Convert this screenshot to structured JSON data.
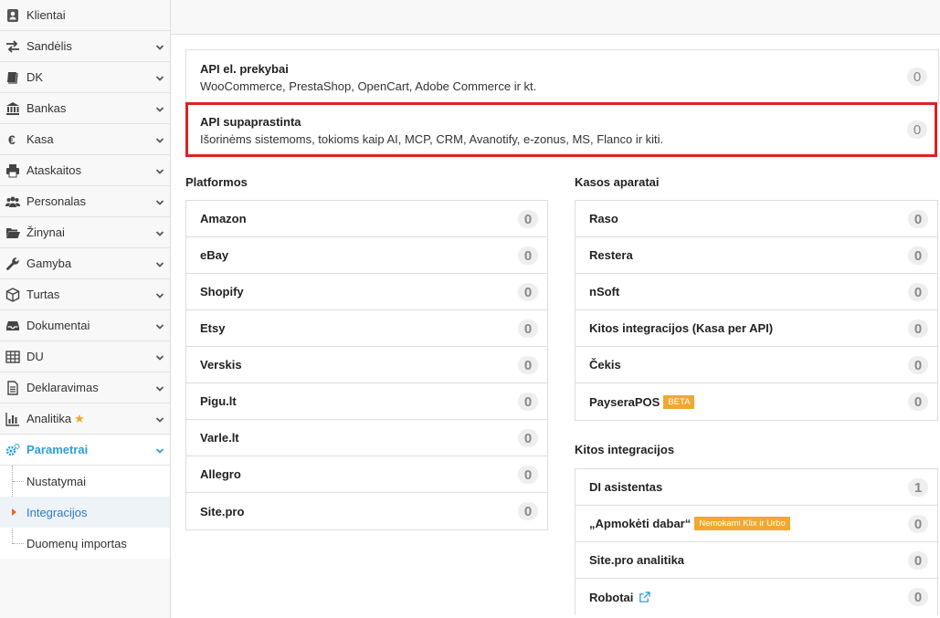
{
  "sidebar": {
    "items": [
      {
        "label": "Klientai",
        "icon": "user-card-icon",
        "chevron": false
      },
      {
        "label": "Sandėlis",
        "icon": "arrows-exchange-icon",
        "chevron": true
      },
      {
        "label": "DK",
        "icon": "book-icon",
        "chevron": true
      },
      {
        "label": "Bankas",
        "icon": "bank-icon",
        "chevron": true
      },
      {
        "label": "Kasa",
        "icon": "euro-icon",
        "chevron": true
      },
      {
        "label": "Ataskaitos",
        "icon": "printer-icon",
        "chevron": true
      },
      {
        "label": "Personalas",
        "icon": "users-icon",
        "chevron": true
      },
      {
        "label": "Žinynai",
        "icon": "folder-open-icon",
        "chevron": true
      },
      {
        "label": "Gamyba",
        "icon": "wrench-icon",
        "chevron": true
      },
      {
        "label": "Turtas",
        "icon": "cube-icon",
        "chevron": true
      },
      {
        "label": "Dokumentai",
        "icon": "inbox-icon",
        "chevron": true
      },
      {
        "label": "DU",
        "icon": "table-icon",
        "chevron": true
      },
      {
        "label": "Deklaravimas",
        "icon": "file-text-icon",
        "chevron": true
      },
      {
        "label": "Analitika",
        "icon": "bar-chart-icon",
        "chevron": true
      },
      {
        "label": "Parametrai",
        "icon": "gears-icon",
        "chevron": true
      }
    ],
    "subitems": [
      {
        "label": "Nustatymai"
      },
      {
        "label": "Integracijos"
      },
      {
        "label": "Duomenų importas"
      }
    ],
    "accent": "#2a9fd6",
    "star_color": "#f5a623"
  },
  "api": [
    {
      "title": "API el. prekybai",
      "desc": "WooCommerce, PrestaShop, OpenCart, Adobe Commerce ir kt.",
      "count": "0"
    },
    {
      "title": "API supaprastinta",
      "desc": "Išorinėms sistemoms, tokioms kaip AI, MCP, CRM, Avanotify, e-zonus, MS, Flanco ir kiti.",
      "count": "0"
    }
  ],
  "highlight_color": "#d9231f",
  "platformos": {
    "title": "Platformos",
    "rows": [
      {
        "label": "Amazon",
        "count": "0"
      },
      {
        "label": "eBay",
        "count": "0"
      },
      {
        "label": "Shopify",
        "count": "0"
      },
      {
        "label": "Etsy",
        "count": "0"
      },
      {
        "label": "Verskis",
        "count": "0"
      },
      {
        "label": "Pigu.lt",
        "count": "0"
      },
      {
        "label": "Varle.lt",
        "count": "0"
      },
      {
        "label": "Allegro",
        "count": "0"
      },
      {
        "label": "Site.pro",
        "count": "0"
      }
    ]
  },
  "kasos": {
    "title": "Kasos aparatai",
    "rows": [
      {
        "label": "Raso",
        "count": "0"
      },
      {
        "label": "Restera",
        "count": "0"
      },
      {
        "label": "nSoft",
        "count": "0"
      },
      {
        "label": "Kitos integracijos (Kasa per API)",
        "count": "0"
      },
      {
        "label": "Čekis",
        "count": "0"
      },
      {
        "label": "PayseraPOS",
        "tag": "BETA",
        "count": "0"
      }
    ]
  },
  "kitos": {
    "title": "Kitos integracijos",
    "rows": [
      {
        "label": "DI asistentas",
        "count": "1"
      },
      {
        "label": "„Apmokėti dabar“",
        "tag": "Nemokami Klix ir Urbo",
        "count": "0"
      },
      {
        "label": "Site.pro analitika",
        "count": "0"
      },
      {
        "label": "Robotai",
        "icon": "external-link-icon",
        "count": "0"
      }
    ]
  },
  "tag_color": "#f0a830"
}
